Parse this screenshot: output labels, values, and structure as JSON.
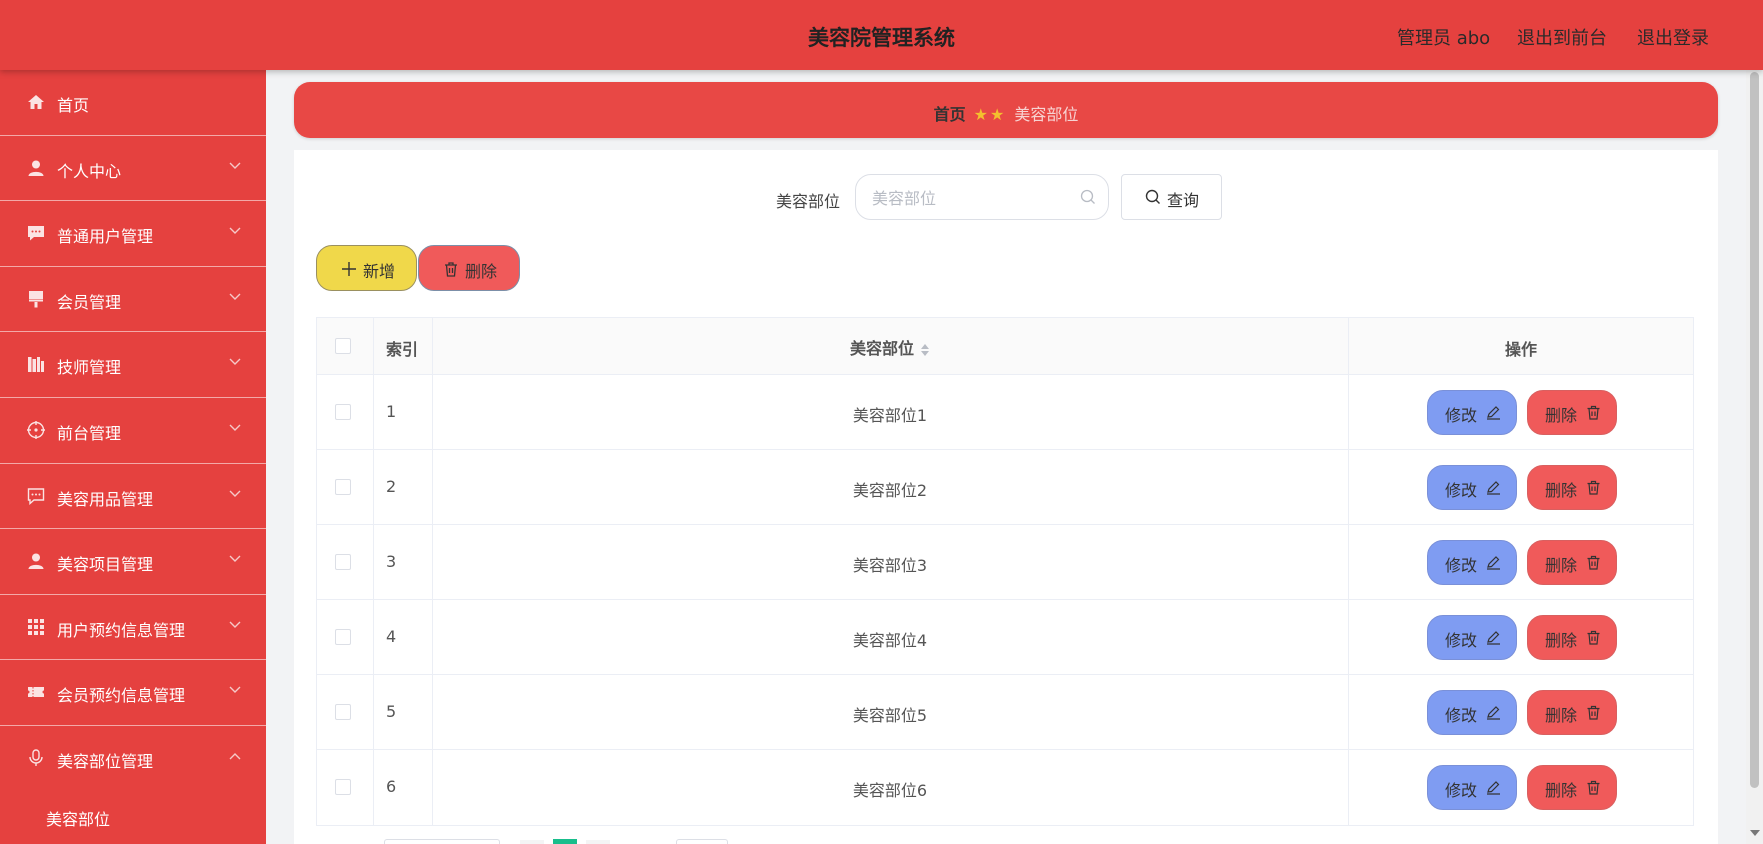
{
  "header": {
    "title": "美容院管理系统",
    "admin_label": "管理员 abo",
    "to_front_label": "退出到前台",
    "logout_label": "退出登录"
  },
  "sidebar": {
    "items": [
      {
        "label": "首页",
        "icon": "home-icon",
        "expandable": false
      },
      {
        "label": "个人中心",
        "icon": "user-icon",
        "expandable": true
      },
      {
        "label": "普通用户管理",
        "icon": "chat-icon",
        "expandable": true
      },
      {
        "label": "会员管理",
        "icon": "brush-icon",
        "expandable": true
      },
      {
        "label": "技师管理",
        "icon": "books-icon",
        "expandable": true
      },
      {
        "label": "前台管理",
        "icon": "target-icon",
        "expandable": true
      },
      {
        "label": "美容用品管理",
        "icon": "comment-icon",
        "expandable": true
      },
      {
        "label": "美容项目管理",
        "icon": "user-icon",
        "expandable": true
      },
      {
        "label": "用户预约信息管理",
        "icon": "grid-icon",
        "expandable": true
      },
      {
        "label": "会员预约信息管理",
        "icon": "ticket-icon",
        "expandable": true
      },
      {
        "label": "美容部位管理",
        "icon": "microphone-icon",
        "expandable": true,
        "expanded": true
      }
    ],
    "sub_item": "美容部位"
  },
  "breadcrumb": {
    "home": "首页",
    "current": "美容部位"
  },
  "search": {
    "label": "美容部位",
    "placeholder": "美容部位",
    "value": "",
    "query_label": "查询"
  },
  "actions": {
    "add_label": "新增",
    "delete_label": "删除"
  },
  "table": {
    "headers": {
      "index": "索引",
      "name": "美容部位",
      "ops": "操作"
    },
    "edit_label": "修改",
    "delete_label": "删除",
    "rows": [
      {
        "index": "1",
        "name": "美容部位1"
      },
      {
        "index": "2",
        "name": "美容部位2"
      },
      {
        "index": "3",
        "name": "美容部位3"
      },
      {
        "index": "4",
        "name": "美容部位4"
      },
      {
        "index": "5",
        "name": "美容部位5"
      },
      {
        "index": "6",
        "name": "美容部位6"
      }
    ]
  },
  "colors": {
    "brand": "#e5413f",
    "add_button": "#f0d84a",
    "delete_button": "#f05a5a",
    "edit_button": "#7f9cf2",
    "star": "#f3c02e"
  }
}
